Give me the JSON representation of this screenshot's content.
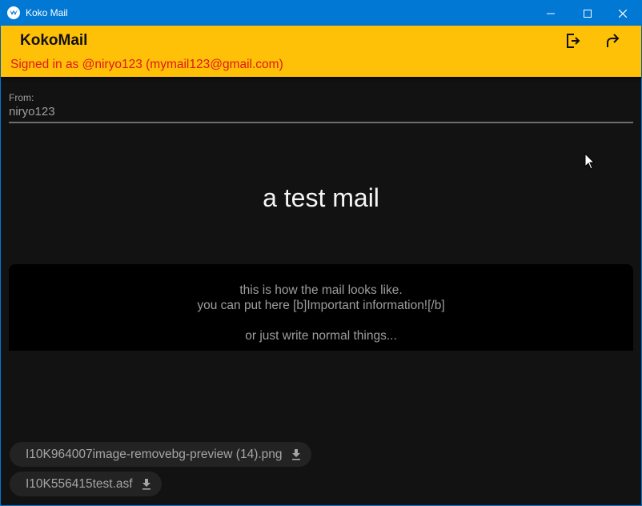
{
  "window": {
    "title": "Koko Mail"
  },
  "appbar": {
    "app_name": "KokoMail",
    "signed_in": "Signed in as @niryo123 (mymail123@gmail.com)",
    "actions": [
      "logout-icon",
      "reply-icon"
    ]
  },
  "mail": {
    "from_label": "From:",
    "from_value": "niryo123",
    "subject": "a test mail",
    "body_lines": [
      "this is how the mail looks like.",
      "you can put here [b]Important information![/b]",
      "",
      "or just write normal things..."
    ]
  },
  "attachments": [
    {
      "name": "I10K964007image-removebg-preview (14).png",
      "icon": "download-icon"
    },
    {
      "name": "I10K556415test.asf",
      "icon": "download-icon"
    }
  ],
  "colors": {
    "titlebar": "#0078d4",
    "appbar": "#ffc107",
    "signed_in_text": "#e01717",
    "background": "#121212",
    "body_box": "#000000"
  }
}
